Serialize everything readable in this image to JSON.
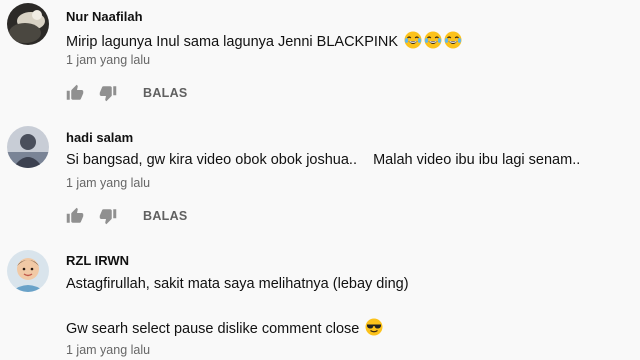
{
  "comments": [
    {
      "author": "Nur Naafilah",
      "text": "Mirip lagunya Inul sama lagunya Jenni BLACKPINK",
      "emojis": [
        "face-with-tears-of-joy",
        "face-with-tears-of-joy",
        "face-with-tears-of-joy"
      ],
      "time": "1 jam yang lalu",
      "reply_label": "BALAS"
    },
    {
      "author": "hadi salam",
      "text": "Si bangsad, gw kira video obok obok joshua..    Malah video ibu ibu lagi senam..",
      "time": "1 jam yang lalu",
      "reply_label": "BALAS"
    },
    {
      "author": "RZL IRWN",
      "text_line1": "Astagfirullah, sakit mata saya melihatnya (lebay ding)",
      "text_line2": "Gw searh select pause dislike comment close",
      "emojis": [
        "smiling-face-with-sunglasses"
      ],
      "time": "1 jam yang lalu"
    }
  ],
  "icons": {
    "like": "thumb-up-icon",
    "dislike": "thumb-down-icon"
  },
  "colors": {
    "background": "#f9f9f9",
    "text": "#111111",
    "secondary_text": "#666666",
    "icon": "#909090"
  }
}
